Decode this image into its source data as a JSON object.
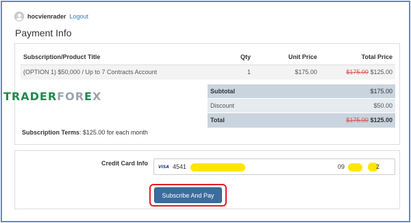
{
  "header": {
    "username": "hocvienrader",
    "logout_label": "Logout"
  },
  "page_title": "Payment Info",
  "items_table": {
    "columns": [
      "Subscription/Product Title",
      "Qty",
      "Unit Price",
      "Total Price"
    ],
    "rows": [
      {
        "title": "(OPTION 1) $50,000 / Up to 7 Contracts Account",
        "qty": "1",
        "unit_price": "$175.00",
        "total_original": "$175.00",
        "total_price": "$125.00"
      }
    ]
  },
  "totals": {
    "subtotal_label": "Subtotal",
    "subtotal_value": "$175.00",
    "discount_label": "Discount",
    "discount_value": "$50.00",
    "total_label": "Total",
    "total_original": "$175.00",
    "total_value": "$125.00"
  },
  "watermark": {
    "part_a": "TRADER",
    "part_b": "FOR",
    "part_c": "E",
    "part_d": "X"
  },
  "terms": {
    "label": "Subscription Terms",
    "value": ": $125.00 for each month"
  },
  "payment": {
    "cc_label": "Credit Card Info",
    "card_brand": "VISA",
    "card_prefix": "4541",
    "exp_prefix": "09",
    "cvv_suffix": "2"
  },
  "submit_label": "Subscribe And Pay",
  "colors": {
    "accent": "#337ab7",
    "button": "#3c6c9e",
    "highlight": "#e31b23",
    "strike": "#d9534f"
  }
}
